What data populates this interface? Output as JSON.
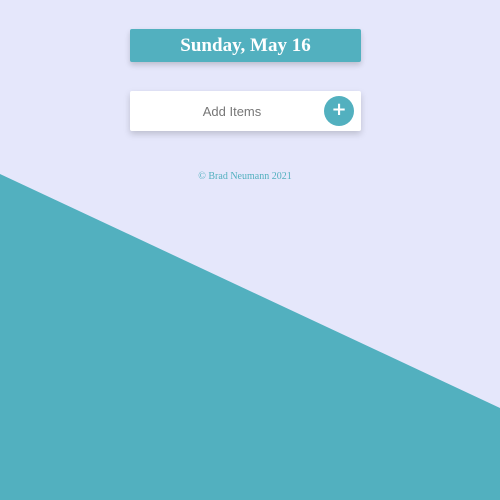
{
  "header": {
    "date": "Sunday, May 16"
  },
  "add_form": {
    "placeholder": "Add Items",
    "button_icon": "plus-icon",
    "button_symbol": "+"
  },
  "footer": {
    "copyright": "© Brad Neumann 2021"
  },
  "colors": {
    "background": "#e5e7fb",
    "accent": "#52b0bf",
    "card": "#ffffff"
  }
}
